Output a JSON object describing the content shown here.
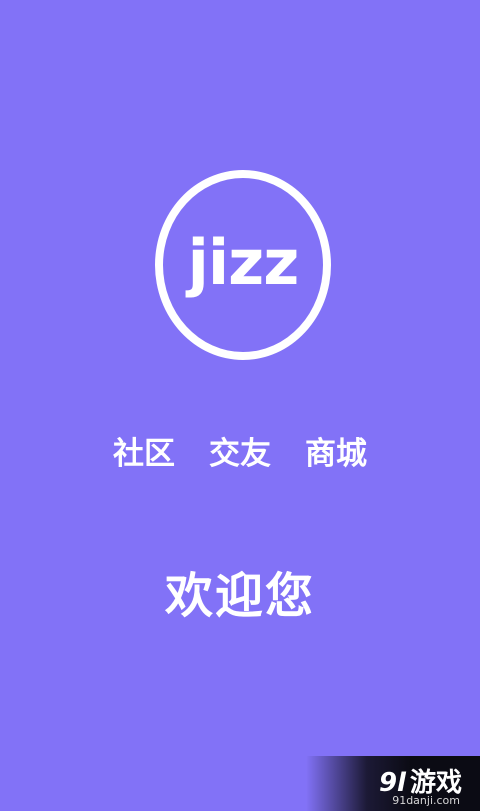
{
  "background_color": "#8272f7",
  "logo": {
    "text": "jizz"
  },
  "tagline": {
    "items": [
      "社区",
      "交友",
      "商城"
    ]
  },
  "welcome": {
    "text": "欢迎您"
  },
  "watermark": {
    "number": "9l",
    "name": "游戏",
    "url": "91danji.com"
  }
}
